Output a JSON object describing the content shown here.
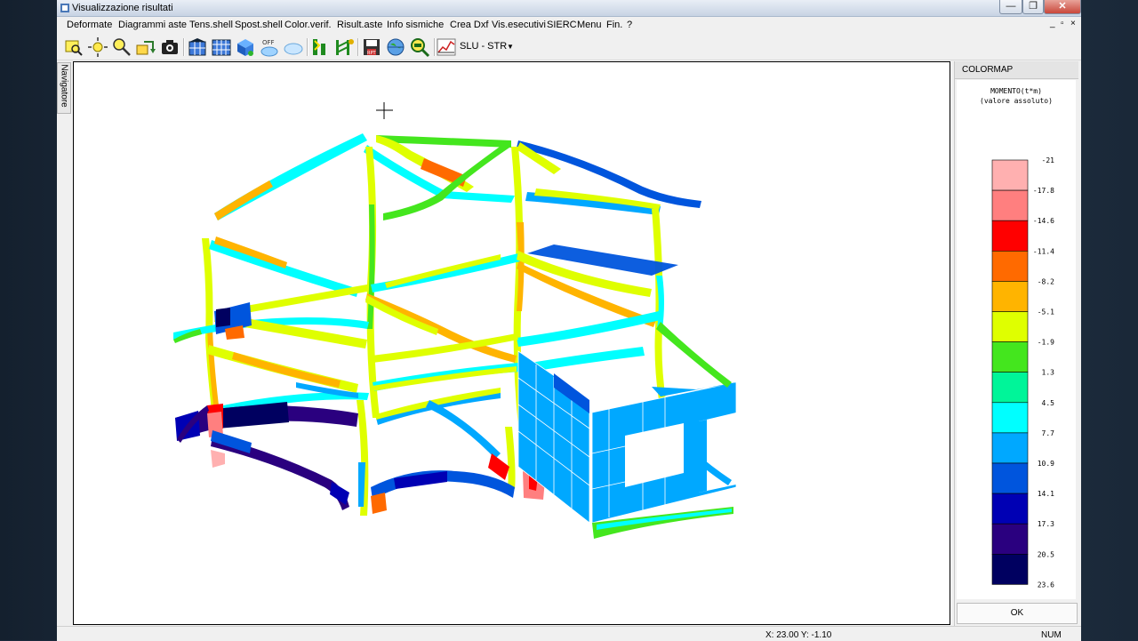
{
  "window": {
    "title": "Visualizzazione risultati",
    "minimize": "—",
    "maximize": "❐",
    "close": "✕"
  },
  "menu": [
    "Deformate",
    "Diagrammi aste",
    "Tens.shell",
    "Spost.shell",
    "Color.verif.",
    "Risult.aste",
    "Info sismiche",
    "Crea Dxf",
    "Vis.esecutivi",
    "SIERC",
    "Menu",
    "Fin.",
    "?"
  ],
  "mdi_controls": [
    "_",
    "▫",
    "×"
  ],
  "toolbar": {
    "icons": [
      "zoom-window-icon",
      "zoom-all-icon",
      "zoom-icon",
      "rotate-icon",
      "camera-icon",
      "frame-view-icon",
      "grid-view-icon",
      "solid-view-icon",
      "off-icon",
      "cloud-icon",
      "load-icon",
      "structure-icon",
      "save-icon",
      "globe-icon",
      "zoom-extents-icon",
      "graph-icon",
      "formula-icon"
    ],
    "combo_value": "SLU - STR",
    "combo_arrow": "▼"
  },
  "navigator_label": "Navigatore",
  "colormap": {
    "header": "COLORMAP",
    "title_line1": "MOMENTO(t*m)",
    "title_line2": "(valore assoluto)",
    "labels": [
      "-21",
      "-17.8",
      "-14.6",
      "-11.4",
      "-8.2",
      "-5.1",
      "-1.9",
      "1.3",
      "4.5",
      "7.7",
      "10.9",
      "14.1",
      "17.3",
      "20.5",
      "23.6"
    ],
    "colors": [
      "#ffb0b0",
      "#ff7f7f",
      "#ff0000",
      "#ff6a00",
      "#ffb400",
      "#dfff00",
      "#44e61e",
      "#00f599",
      "#00ffff",
      "#00a8ff",
      "#0055dd",
      "#0000b4",
      "#2a007f",
      "#000060"
    ],
    "ok_label": "OK"
  },
  "status": {
    "coords": "X: 23.00   Y: -1.10",
    "num": "NUM"
  }
}
